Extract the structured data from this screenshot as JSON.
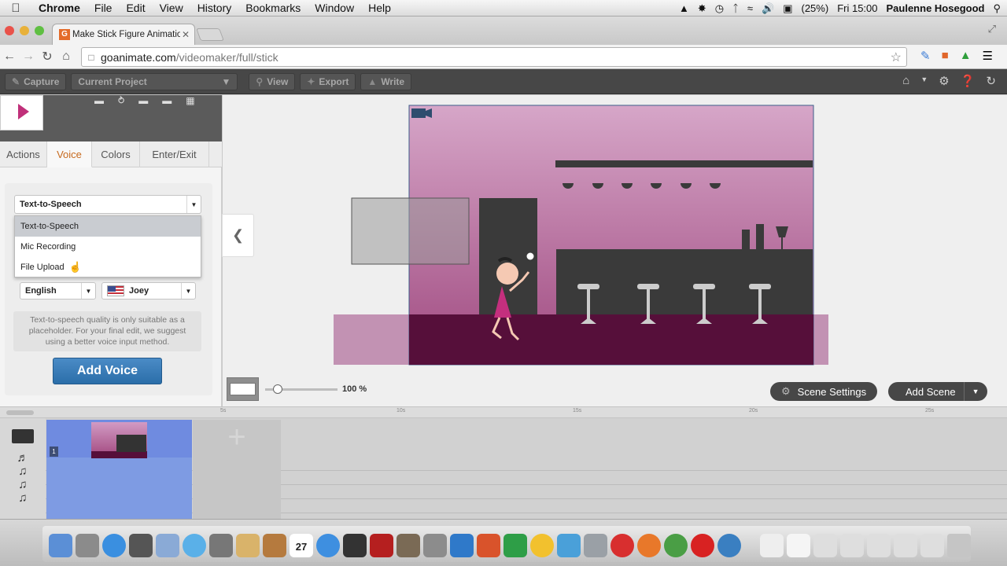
{
  "menubar": {
    "app_name": "Chrome",
    "items": [
      "File",
      "Edit",
      "View",
      "History",
      "Bookmarks",
      "Window",
      "Help"
    ],
    "battery": "(25%)",
    "clock": "Fri 15:00",
    "user": "Paulenne Hosegood"
  },
  "browser": {
    "tab_title": "Make Stick Figure Animatio",
    "url_host": "goanimate.com",
    "url_path": "/videomaker/full/stick"
  },
  "appbar": {
    "capture": "Capture",
    "project": "Current Project",
    "view": "View",
    "export": "Export",
    "write": "Write"
  },
  "panel": {
    "tabs": [
      "Actions",
      "Voice",
      "Colors",
      "Enter/Exit"
    ],
    "active_tab": "Voice",
    "voice_type_selected": "Text-to-Speech",
    "dropdown_options": [
      "Text-to-Speech",
      "Mic Recording",
      "File Upload"
    ],
    "language": "English",
    "voice": "Joey",
    "note": "Text-to-speech quality is only suitable as a placeholder. For your final edit, we suggest using a better voice input method.",
    "add_voice": "Add Voice"
  },
  "stage": {
    "zoom": "100 %",
    "scene_settings": "Scene Settings",
    "add_scene": "Add Scene"
  },
  "timeline": {
    "ruler_labels": [
      "5s",
      "10s",
      "15s",
      "20s",
      "25s"
    ],
    "scene_number": "1"
  },
  "dock": {
    "calendar_day": "27"
  },
  "colors": {
    "accent_tab": "#c76a1e",
    "add_voice_button": "#2b6ea9",
    "scene_floor": "#560f3a",
    "scene_wall_top": "#d6a6c8",
    "scene_wall_bottom": "#a04a80",
    "timeline_scene": "#6f8be0"
  }
}
